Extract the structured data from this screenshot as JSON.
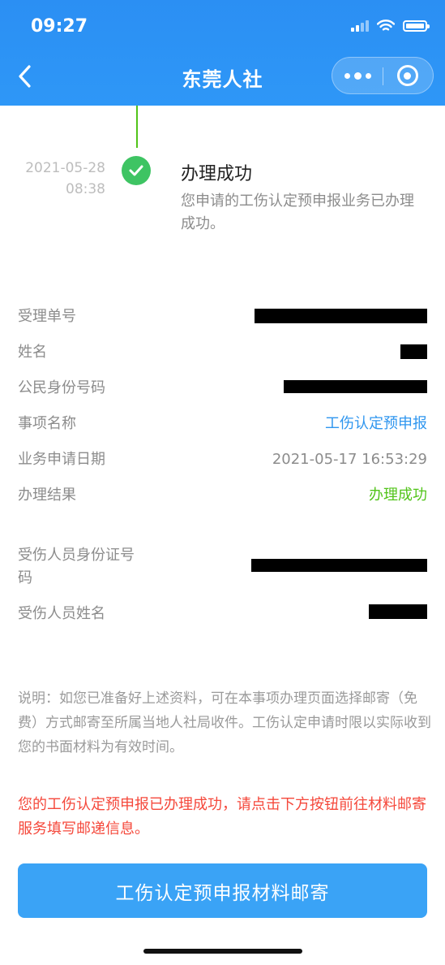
{
  "status_bar": {
    "time": "09:27"
  },
  "nav": {
    "title": "东莞人社"
  },
  "colors": {
    "header_blue": "#2e95f5",
    "success_green": "#52c41a",
    "link_blue": "#2f96ef",
    "alert_red": "#f5483b",
    "button_blue": "#3aa3f6"
  },
  "timeline": {
    "date": "2021-05-28",
    "time": "08:38",
    "title": "办理成功",
    "description": "您申请的工伤认定预申报业务已办理成功。"
  },
  "details": [
    {
      "label": "受理单号",
      "value": ""
    },
    {
      "label": "姓名",
      "value": ""
    },
    {
      "label": "公民身份号码",
      "value": ""
    },
    {
      "label": "事项名称",
      "value": "工伤认定预申报"
    },
    {
      "label": "业务申请日期",
      "value": "2021-05-17 16:53:29"
    },
    {
      "label": "办理结果",
      "value": "办理成功"
    },
    {
      "label": "受伤人员身份证号码",
      "value": ""
    },
    {
      "label": "受伤人员姓名",
      "value": ""
    }
  ],
  "note": "说明：如您已准备好上述资料，可在本事项办理页面选择邮寄（免费）方式邮寄至所属当地人社局收件。工伤认定申请时限以实际收到您的书面材料为有效时间。",
  "notice": "您的工伤认定预申报已办理成功，请点击下方按钮前往材料邮寄服务填写邮递信息。",
  "cta": {
    "label": "工伤认定预申报材料邮寄"
  }
}
